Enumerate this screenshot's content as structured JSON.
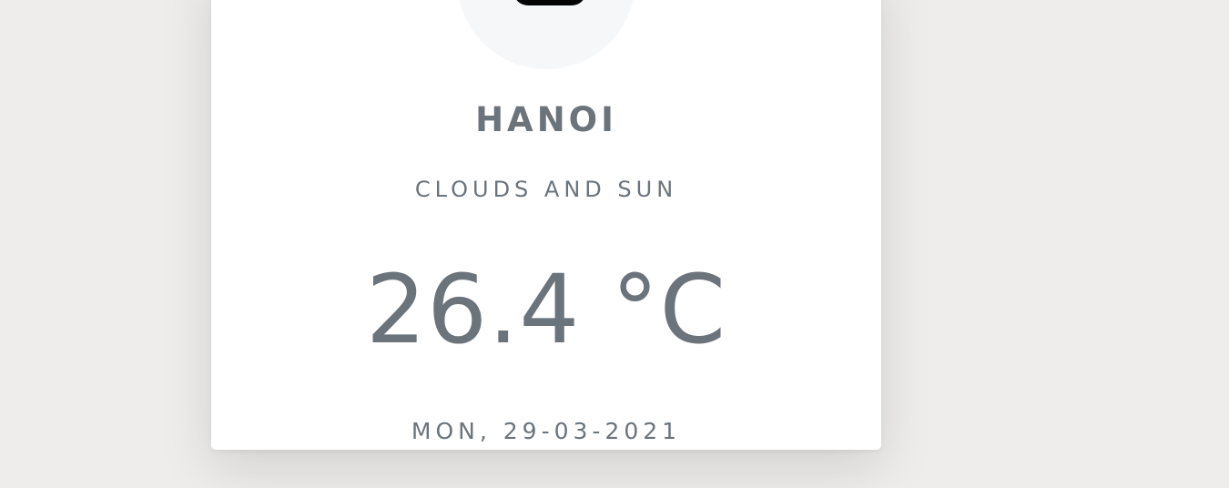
{
  "weather": {
    "icon_name": "clouds-and-sun-icon",
    "city": "HANOI",
    "condition": "CLOUDS AND SUN",
    "temperature": "26.4 °C",
    "date": "MON, 29-03-2021"
  },
  "colors": {
    "background": "#eeedeb",
    "card": "#ffffff",
    "text": "#6b737b",
    "icon_background": "#f6f7f9",
    "icon": "#050505"
  }
}
